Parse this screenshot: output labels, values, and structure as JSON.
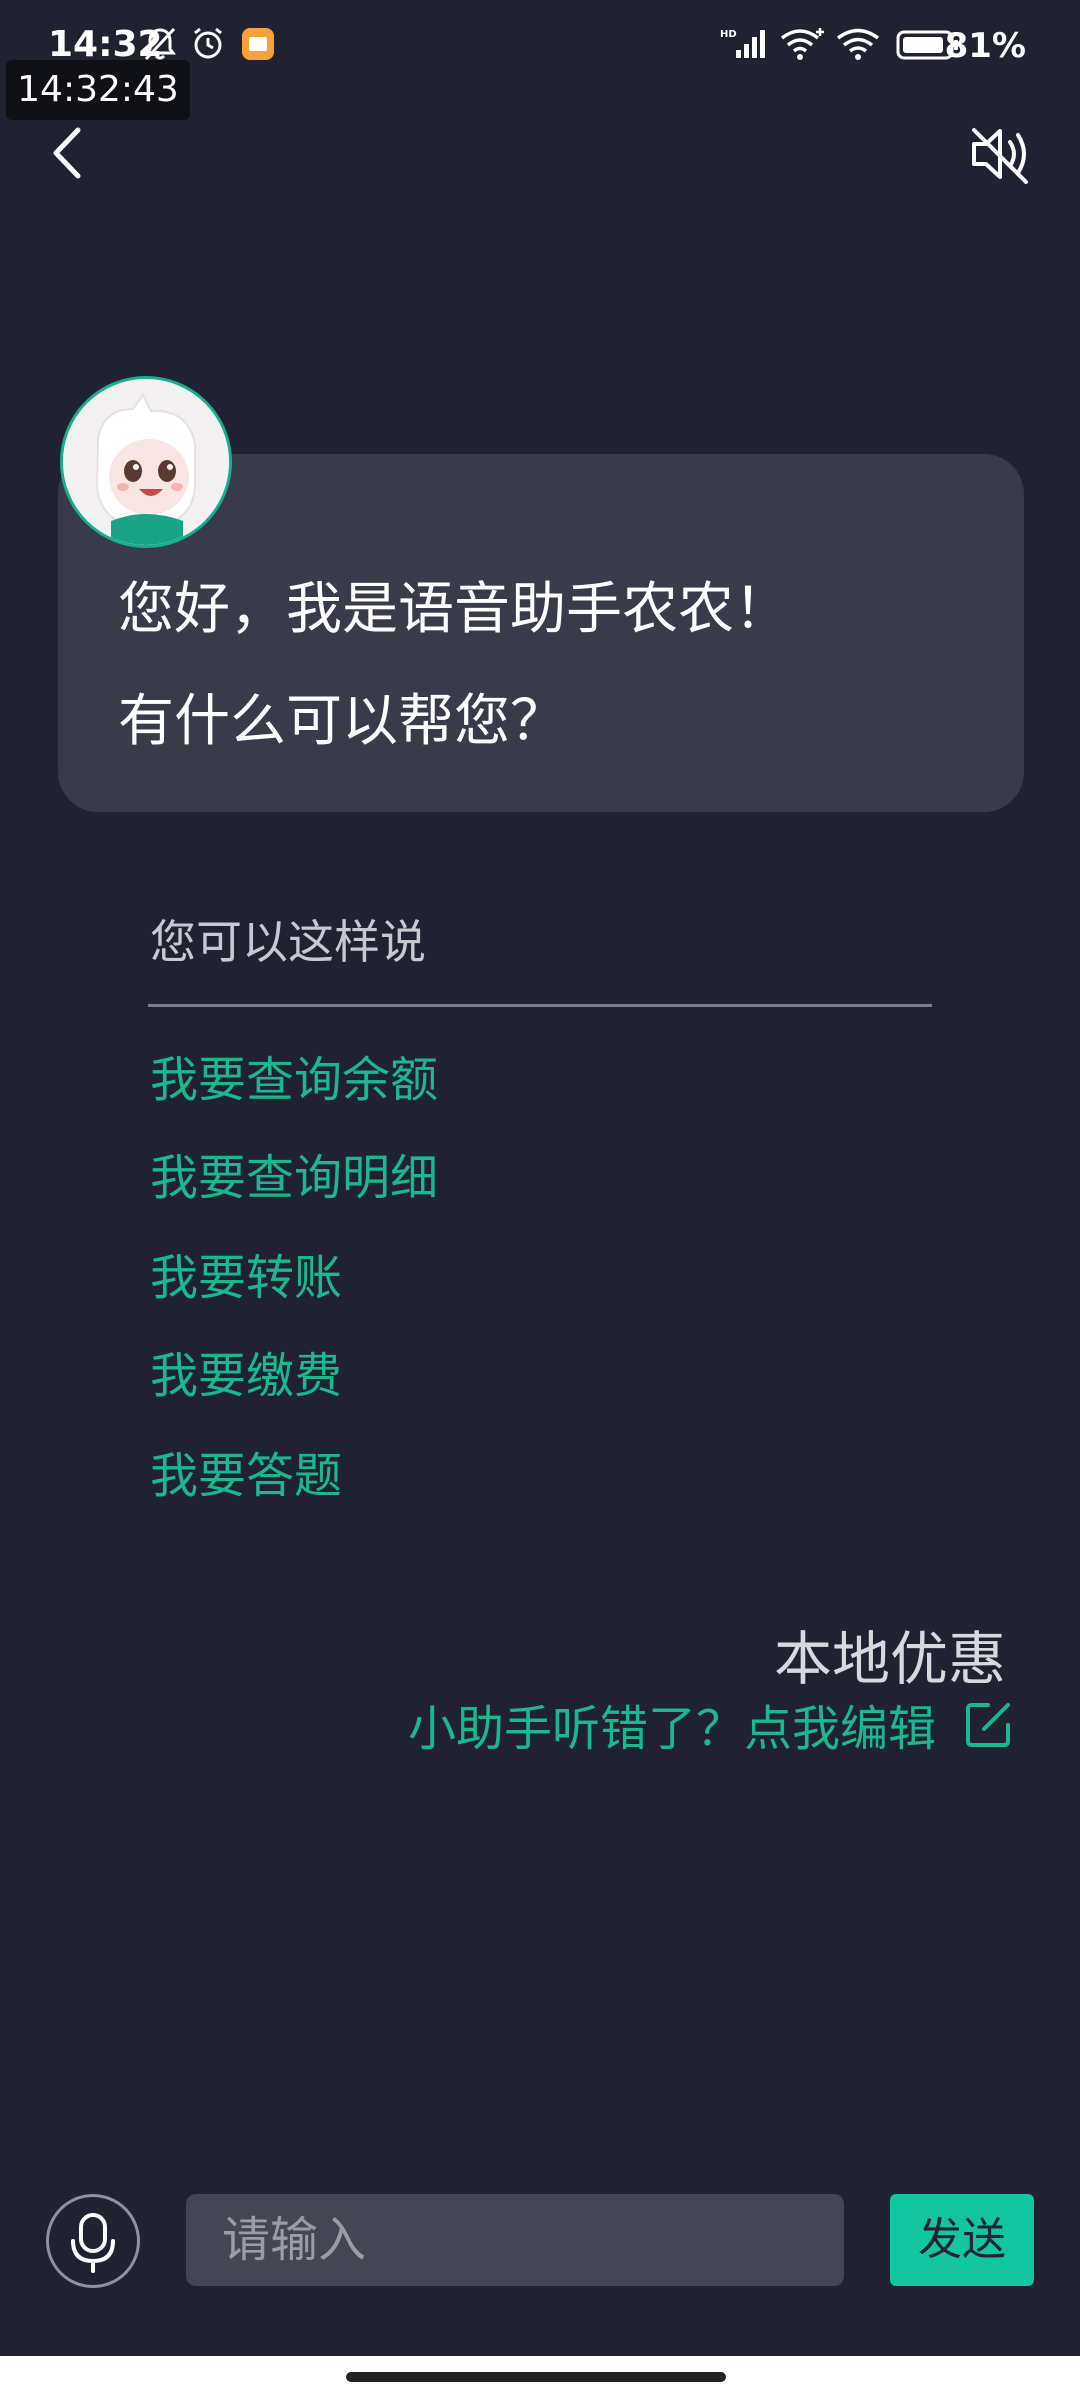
{
  "status_bar": {
    "time": "14:32",
    "battery_percent": "81%",
    "overlay_time": "14:32:43",
    "icons": [
      "bell-off-icon",
      "alarm-icon",
      "notification-app-icon",
      "hd-signal-icon",
      "wifi-plus-icon",
      "wifi-icon",
      "battery-icon"
    ]
  },
  "header": {
    "back_icon": "chevron-left-icon",
    "mute_icon": "speaker-muted-icon"
  },
  "assistant": {
    "greeting_line1": "您好，我是语音助手农农！",
    "greeting_line2": "有什么可以帮您？"
  },
  "suggestions": {
    "title": "您可以这样说",
    "items": [
      "我要查询余额",
      "我要查询明细",
      "我要转账",
      "我要缴费",
      "我要答题"
    ]
  },
  "user_message": {
    "text": "本地优惠",
    "edit_prompt": "小助手听错了？点我编辑"
  },
  "input_bar": {
    "placeholder": "请输入",
    "value": "",
    "send_label": "发送"
  },
  "colors": {
    "background": "#202231",
    "bubble": "#393b4b",
    "accent": "#1ab794",
    "send_button": "#12c6a0"
  }
}
